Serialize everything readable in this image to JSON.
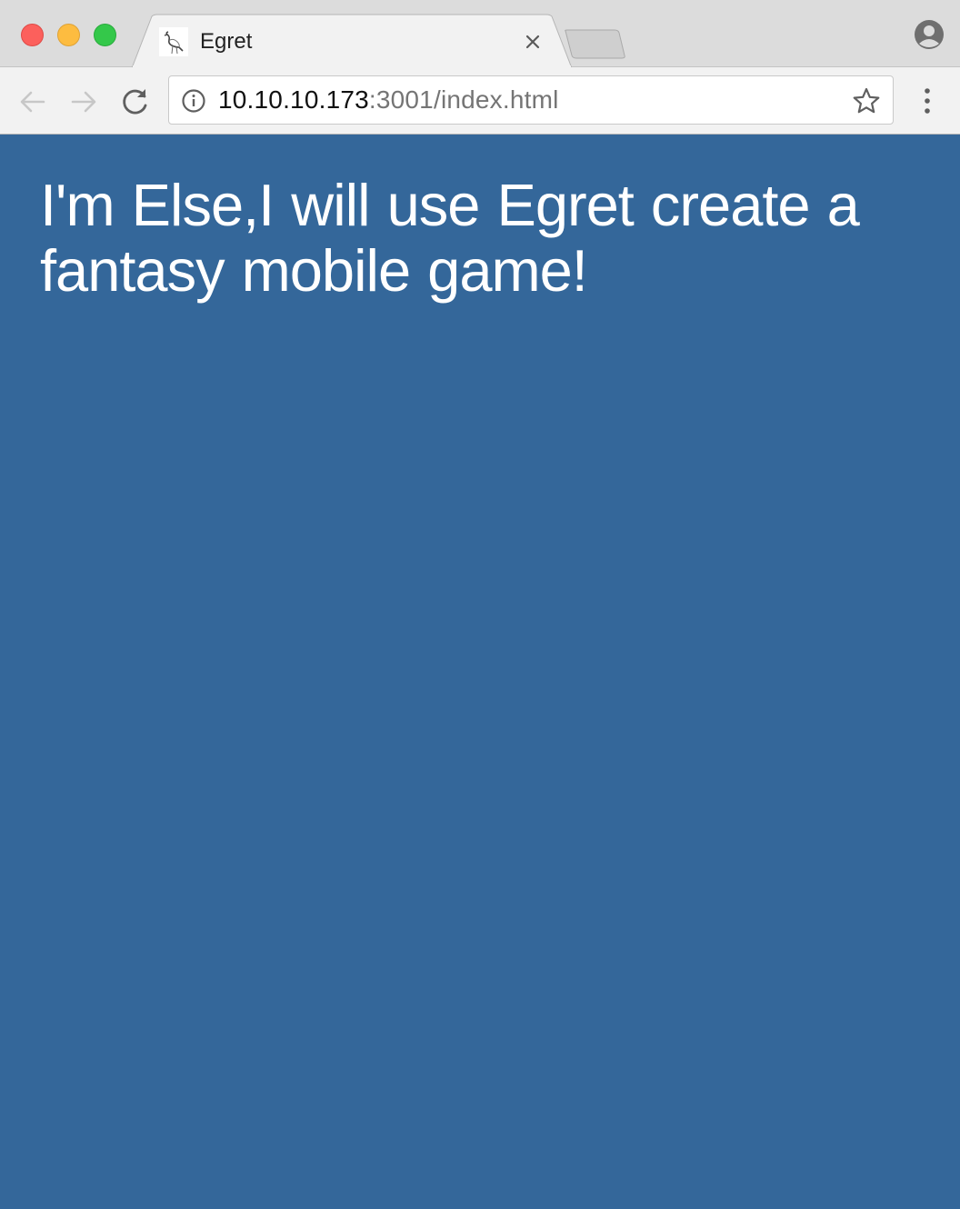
{
  "browser": {
    "tab": {
      "title": "Egret",
      "favicon": "egret-bird-icon"
    },
    "address_bar": {
      "host": "10.10.10.173",
      "rest": ":3001/index.html",
      "info_icon": "info-icon",
      "bookmark_icon": "star-icon"
    },
    "icons": {
      "back": "arrow-left-icon",
      "forward": "arrow-right-icon",
      "reload": "reload-icon",
      "menu": "vertical-dots-icon",
      "profile": "profile-icon",
      "close_tab": "close-icon"
    }
  },
  "page": {
    "background": "#34679a",
    "headline": "I'm Else,I will use Egret create a fantasy mobile game!"
  }
}
